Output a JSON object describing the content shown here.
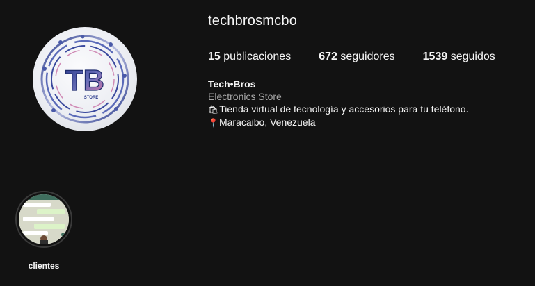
{
  "profile": {
    "username": "techbrosmcbo",
    "avatar_initials": "TB",
    "avatar_sub": "STORE"
  },
  "stats": {
    "posts_count": "15",
    "posts_label": "publicaciones",
    "followers_count": "672",
    "followers_label": "seguidores",
    "following_count": "1539",
    "following_label": "seguidos"
  },
  "bio": {
    "name": "Tech•Bros",
    "category": "Electronics Store",
    "line1_icon": "shopping-bags-emoji",
    "line1_text": "Tienda virtual de tecnología y accesorios para tu teléfono.",
    "line2_icon": "round-pushpin-emoji",
    "line2_text": "Maracaibo, Venezuela"
  },
  "highlights": [
    {
      "label": "clientes"
    }
  ],
  "colors": {
    "background": "#121212",
    "text": "#f5f5f5",
    "secondary_text": "#a8a8a8",
    "avatar_accent": "#3a4fa0",
    "avatar_highlight": "#d66b9b"
  }
}
